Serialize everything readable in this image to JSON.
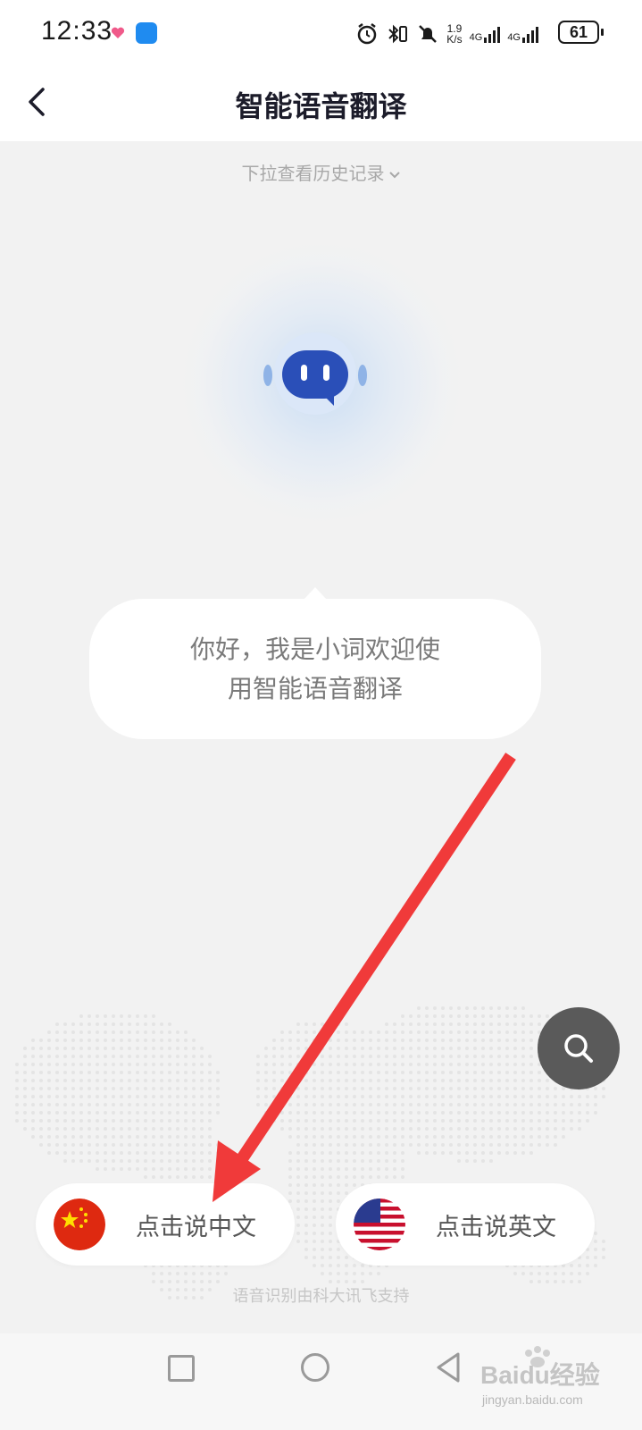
{
  "status_bar": {
    "time": "12:33",
    "net_speed_top": "1.9",
    "net_speed_bottom": "K/s",
    "signal1_label": "4G",
    "signal2_label": "4G",
    "battery": "61"
  },
  "header": {
    "title": "智能语音翻译"
  },
  "history_hint": "下拉查看历史记录",
  "bubble": {
    "line1": "你好，我是小词欢迎使",
    "line2": "用智能语音翻译"
  },
  "buttons": {
    "chinese": "点击说中文",
    "english": "点击说英文"
  },
  "credit": "语音识别由科大讯飞支持",
  "watermark": {
    "brand": "Baidu经验",
    "url": "jingyan.baidu.com"
  },
  "colors": {
    "background": "#f2f2f2",
    "robot_blue": "#2a4fb8",
    "annotation_red": "#f03a3a",
    "fab_gray": "#5a5a5a"
  }
}
